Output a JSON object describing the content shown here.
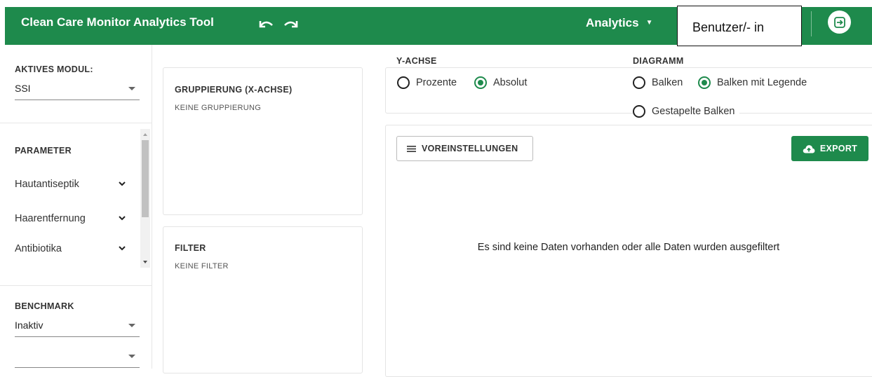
{
  "header": {
    "app_title": "Clean Care Monitor Analytics Tool",
    "undo_icon": "undo-icon",
    "redo_icon": "redo-icon",
    "analytics_menu": "Analytics",
    "user_label": "Benutzer/- in",
    "logout_icon": "logout-icon",
    "accent_color": "#1e8a4c"
  },
  "sidebar": {
    "active_module_label": "AKTIVES MODUL:",
    "active_module_value": "SSI",
    "parameter_label": "PARAMETER",
    "parameters": [
      {
        "label": "Hautantiseptik"
      },
      {
        "label": "Haarentfernung"
      },
      {
        "label": "Antibiotika"
      }
    ],
    "benchmark_label": "BENCHMARK",
    "benchmark_value": "Inaktiv",
    "second_select_value": ""
  },
  "grouping": {
    "title": "GRUPPIERUNG (X-ACHSE)",
    "value": "KEINE GRUPPIERUNG"
  },
  "filter": {
    "title": "FILTER",
    "value": "KEINE FILTER"
  },
  "y_axis": {
    "label": "Y-ACHSE",
    "options": [
      {
        "label": "Prozente",
        "selected": false
      },
      {
        "label": "Absolut",
        "selected": true
      }
    ]
  },
  "diagram": {
    "label": "DIAGRAMM",
    "options": [
      {
        "label": "Balken",
        "selected": false
      },
      {
        "label": "Balken mit Legende",
        "selected": true
      },
      {
        "label": "Gestapelte Balken",
        "selected": false
      }
    ]
  },
  "toolbar": {
    "presets_label": "VOREINSTELLUNGEN",
    "export_label": "EXPORT"
  },
  "chart_area": {
    "empty_message": "Es sind keine Daten vorhanden oder alle Daten wurden ausgefiltert"
  }
}
